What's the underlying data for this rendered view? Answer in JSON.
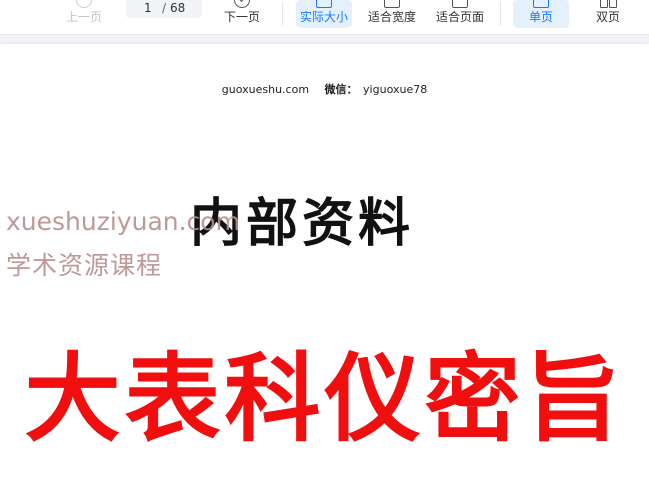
{
  "toolbar": {
    "prev_label": "上一页",
    "next_label": "下一页",
    "current_page": "1",
    "page_separator": "/",
    "total_pages": "68",
    "actual_size_label": "实际大小",
    "fit_width_label": "适合宽度",
    "fit_page_label": "适合页面",
    "single_page_label": "单页",
    "double_page_label": "双页",
    "accent_color": "#1677ff"
  },
  "document": {
    "header_site": "guoxueshu.com",
    "header_wechat_label": "微信：",
    "header_wechat_id": "yiguoxue78",
    "title": "内部资料",
    "subtitle": "大表科仪密旨",
    "subtitle_color": "#f00e0e",
    "watermark_line1": "xueshuziyuan.com",
    "watermark_line2": "学术资源课程"
  }
}
